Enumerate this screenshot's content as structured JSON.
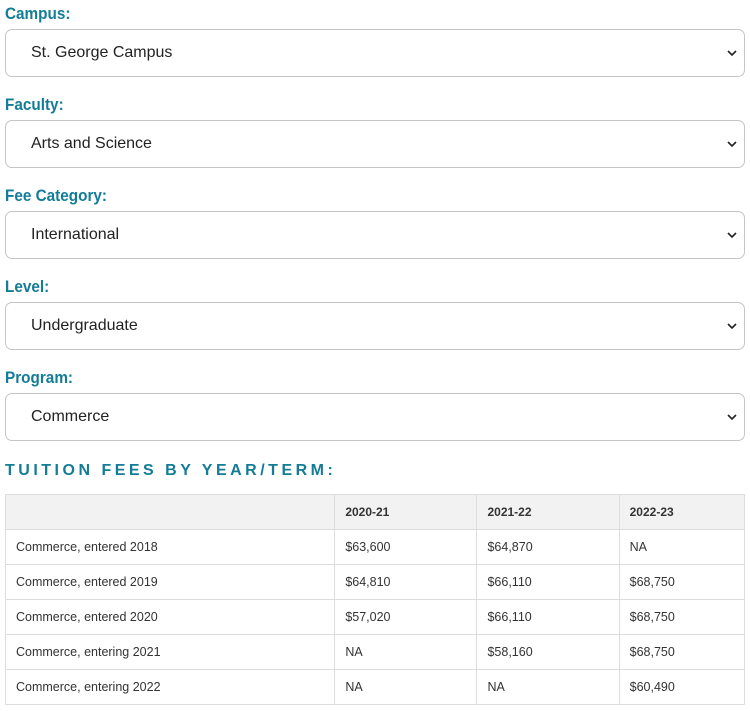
{
  "form": {
    "fields": [
      {
        "label": "Campus:",
        "value": "St. George Campus"
      },
      {
        "label": "Faculty:",
        "value": "Arts and Science"
      },
      {
        "label": "Fee Category:",
        "value": "International"
      },
      {
        "label": "Level:",
        "value": "Undergraduate"
      },
      {
        "label": "Program:",
        "value": "Commerce"
      }
    ],
    "chevron_icon": "chevron-down-icon"
  },
  "section": {
    "heading": "TUITION FEES BY YEAR/TERM:"
  },
  "table": {
    "headers": [
      "",
      "2020-21",
      "2021-22",
      "2022-23"
    ],
    "rows": [
      [
        "Commerce, entered 2018",
        "$63,600",
        "$64,870",
        "NA"
      ],
      [
        "Commerce, entered 2019",
        "$64,810",
        "$66,110",
        "$68,750"
      ],
      [
        "Commerce, entered 2020",
        "$57,020",
        "$66,110",
        "$68,750"
      ],
      [
        "Commerce, entering 2021",
        "NA",
        "$58,160",
        "$68,750"
      ],
      [
        "Commerce, entering 2022",
        "NA",
        "NA",
        "$60,490"
      ]
    ]
  },
  "colors": {
    "accent": "#137c96",
    "border": "#c5c5c5",
    "table_header_bg": "#f2f2f2"
  }
}
